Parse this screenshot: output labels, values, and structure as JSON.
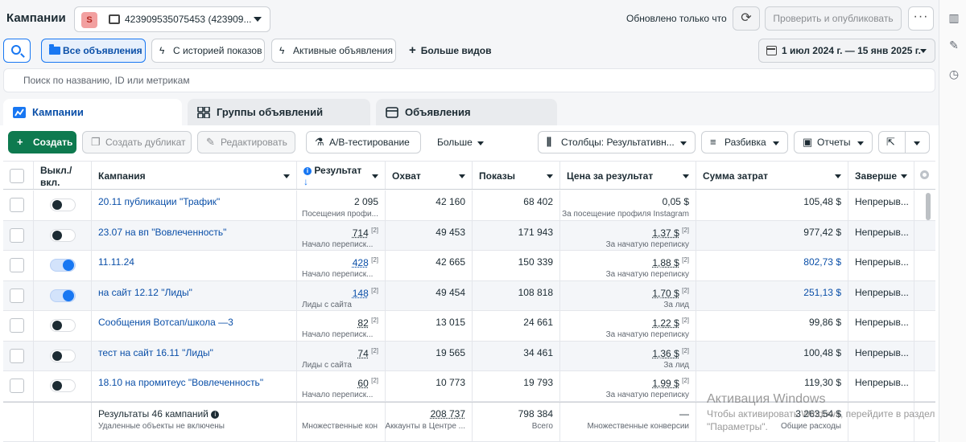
{
  "header": {
    "title": "Кампании",
    "account_badge": "S",
    "account_id": "423909535075453 (423909...",
    "updated": "Обновлено только что",
    "publish_label": "Проверить и опубликовать",
    "more_label": "···"
  },
  "filters": {
    "all_ads": "Все объявления",
    "with_history": "С историей показов",
    "active_ads": "Активные объявления",
    "more_views": "Больше видов",
    "date_range": "1 июл 2024 г. — 15 янв 2025 г."
  },
  "search": {
    "placeholder": "Поиск по названию, ID или метрикам"
  },
  "tabs": [
    {
      "label": "Кампании"
    },
    {
      "label": "Группы объявлений"
    },
    {
      "label": "Объявления"
    }
  ],
  "toolbar": {
    "create": "Создать",
    "duplicate": "Создать дубликат",
    "edit": "Редактировать",
    "ab_test": "A/B-тестирование",
    "more": "Больше",
    "columns": "Столбцы: Результативн...",
    "breakdown": "Разбивка",
    "reports": "Отчеты"
  },
  "table": {
    "headers": {
      "toggle": "Выкл./\nвкл.",
      "campaign": "Кампания",
      "result": "Результат",
      "reach": "Охват",
      "impressions": "Показы",
      "cost_per_result": "Цена за результат",
      "spend": "Сумма затрат",
      "end": "Заверше"
    },
    "rows": [
      {
        "on": false,
        "name": "20.11 публикации \"Трафик\"",
        "result": "2 095",
        "result_sub": "Посещения профи...",
        "reach": "42 160",
        "impressions": "68 402",
        "cpr": "0,05 $",
        "cpr_sub": "За посещение профиля Instagram",
        "spend": "105,48 $",
        "end": "Непрерыв..."
      },
      {
        "on": false,
        "name": "23.07 на вп \"Вовлеченность\"",
        "result": "714",
        "result_sub": "Начало переписк...",
        "reach": "49 453",
        "impressions": "171 943",
        "cpr": "1,37 $",
        "cpr_sub": "За начатую переписку",
        "spend": "977,42 $",
        "end": "Непрерыв..."
      },
      {
        "on": true,
        "name": "11.11.24",
        "result": "428",
        "result_sub": "Начало переписк...",
        "reach": "42 665",
        "impressions": "150 339",
        "cpr": "1,88 $",
        "cpr_sub": "За начатую переписку",
        "spend": "802,73 $",
        "end": "Непрерыв..."
      },
      {
        "on": true,
        "name": "на сайт 12.12 \"Лиды\"",
        "result": "148",
        "result_sub": "Лиды с сайта",
        "reach": "49 454",
        "impressions": "108 818",
        "cpr": "1,70 $",
        "cpr_sub": "За лид",
        "spend": "251,13 $",
        "end": "Непрерыв..."
      },
      {
        "on": false,
        "name": "Сообщения Вотсап/школа —3",
        "result": "82",
        "result_sub": "Начало переписк...",
        "reach": "13 015",
        "impressions": "24 661",
        "cpr": "1,22 $",
        "cpr_sub": "За начатую переписку",
        "spend": "99,86 $",
        "end": "Непрерыв..."
      },
      {
        "on": false,
        "name": "тест на сайт 16.11 \"Лиды\"",
        "result": "74",
        "result_sub": "Лиды с сайта",
        "reach": "19 565",
        "impressions": "34 461",
        "cpr": "1,36 $",
        "cpr_sub": "За лид",
        "spend": "100,48 $",
        "end": "Непрерыв..."
      },
      {
        "on": false,
        "name": "18.10 на промитеус \"Вовлеченность\"",
        "result": "60",
        "result_sub": "Начало переписк...",
        "reach": "10 773",
        "impressions": "19 793",
        "cpr": "1,99 $",
        "cpr_sub": "За начатую переписку",
        "spend": "119,30 $",
        "end": "Непрерыв..."
      }
    ],
    "note_marker": "[2]",
    "totals": {
      "label": "Результаты 46 кампаний",
      "sub": "Удаленные объекты не включены",
      "result_sub": "Множественные кон",
      "reach": "208 737",
      "reach_sub": "Аккаунты в Центре ...",
      "impressions": "798 384",
      "impressions_sub": "Всего",
      "cpr": "—",
      "cpr_sub": "Множественные конверсии",
      "spend": "3 263,54 $",
      "spend_sub": "Общие расходы"
    }
  },
  "watermark": {
    "line1": "Активация Windows",
    "line2": "Чтобы активировать Windows, перейдите в раздел",
    "line3": "\"Параметры\"."
  },
  "colors": {
    "accent": "#1877f2",
    "link": "#0a4fa8",
    "create": "#0e7a4f"
  }
}
